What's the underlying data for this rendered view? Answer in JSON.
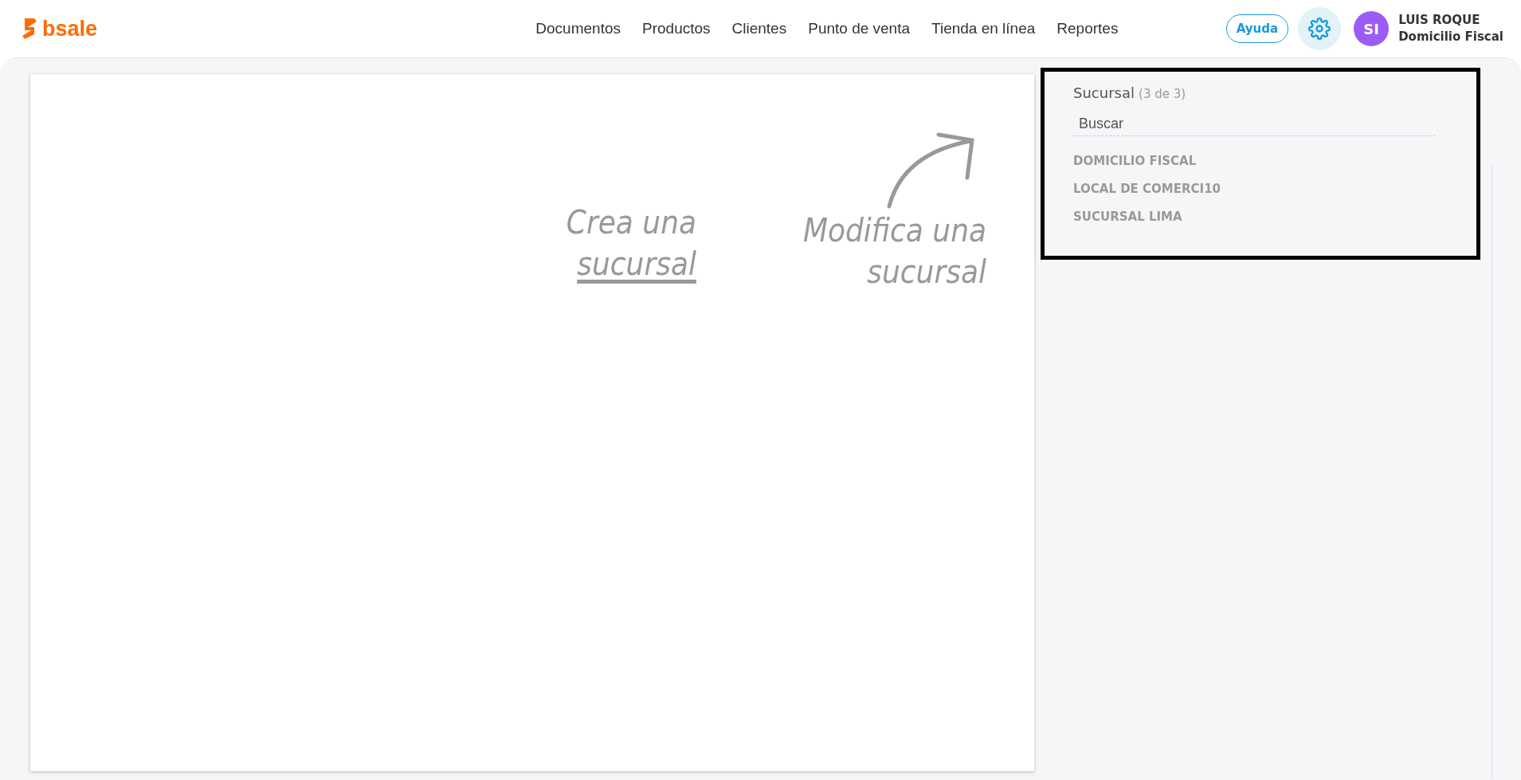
{
  "header": {
    "logo": "bsale",
    "nav": [
      {
        "label": "Documentos"
      },
      {
        "label": "Productos"
      },
      {
        "label": "Clientes"
      },
      {
        "label": "Punto de venta"
      },
      {
        "label": "Tienda en línea"
      },
      {
        "label": "Reportes"
      }
    ],
    "help_button": "Ayuda",
    "user": {
      "initials": "SI",
      "name": "LUIS ROQUE",
      "branch": "Domicilio Fiscal"
    }
  },
  "canvas": {
    "create_hint": {
      "text": "Crea una",
      "link": "sucursal"
    },
    "modify_hint": {
      "line_1": "Modifica una",
      "line_2": "sucursal"
    }
  },
  "branch_panel": {
    "title": "Sucursal",
    "count": "(3 de 3)",
    "search": {
      "placeholder": "Buscar"
    },
    "items": [
      {
        "label": "DOMICILIO FISCAL"
      },
      {
        "label": "LOCAL DE COMERCI10"
      },
      {
        "label": "SUCURSAL LIMA"
      }
    ]
  }
}
